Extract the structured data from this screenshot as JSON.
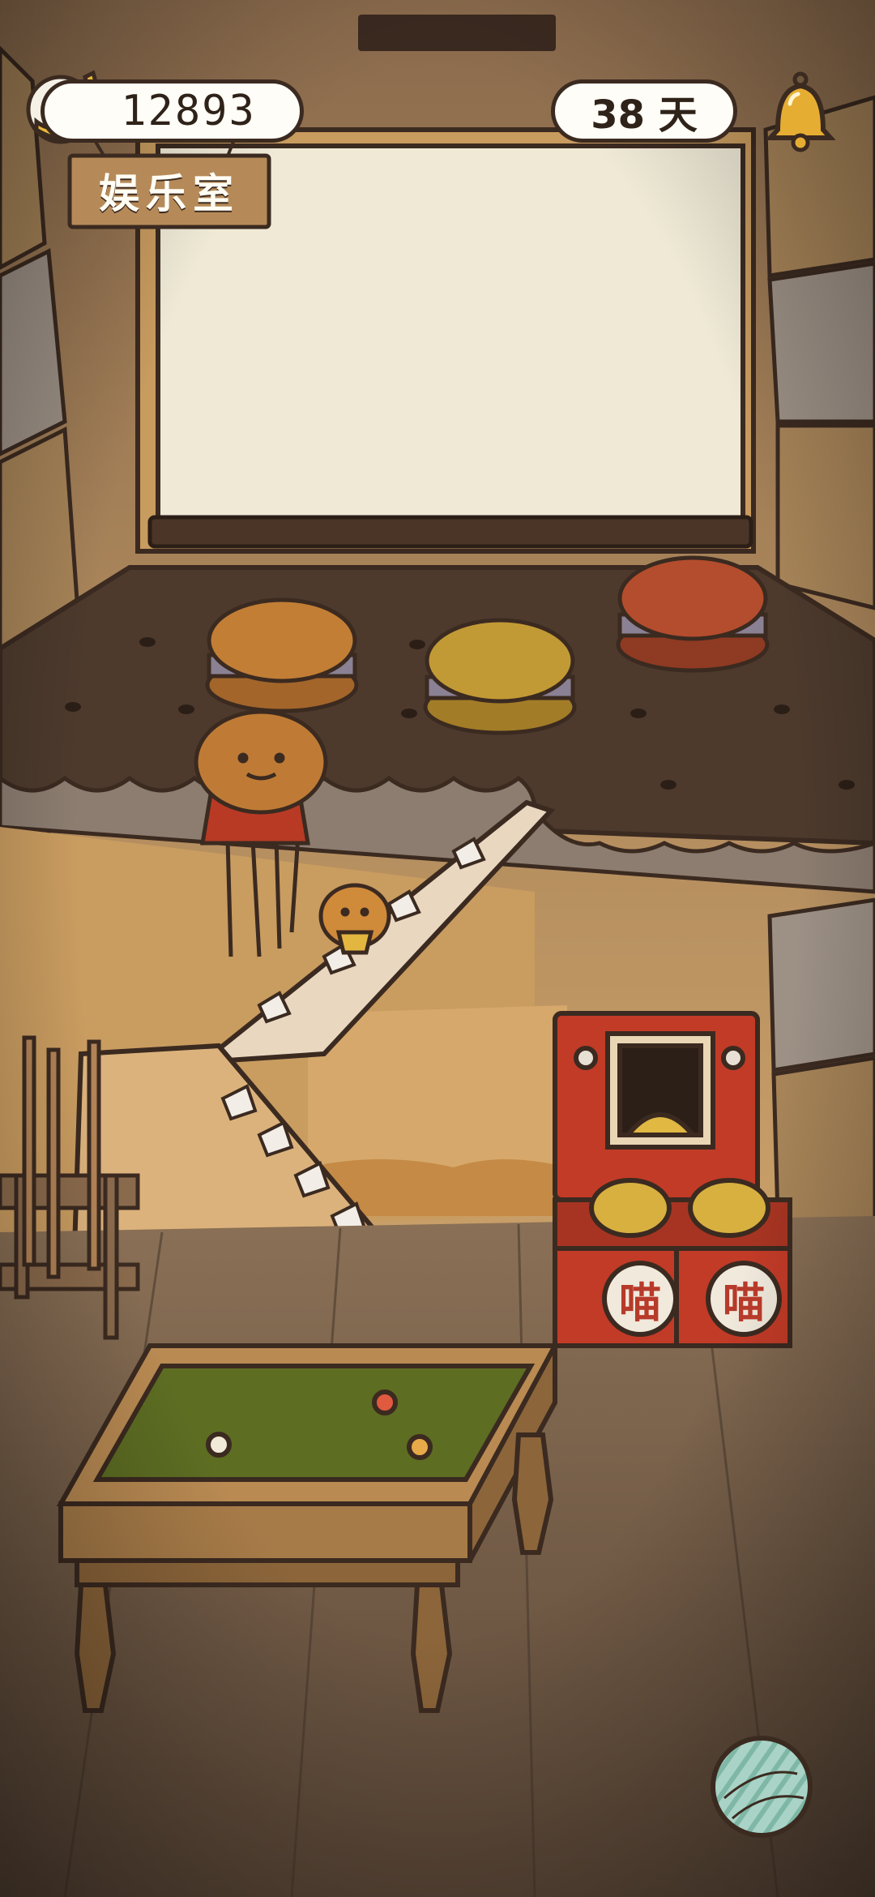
{
  "hud": {
    "banana_count": "12893",
    "days_label": "38 天",
    "room_name": "娱乐室"
  },
  "icons": {
    "currency": "banana-icon",
    "notifications": "bell-icon",
    "menu": "yarn-ball-icon"
  },
  "arcade": {
    "left_label": "喵",
    "right_label": "喵"
  },
  "colors": {
    "wall": "#c9a06a",
    "floor": "#6a5443",
    "screen": "#efe9d6",
    "felt": "#5d6d22",
    "arcade_red": "#c23b27",
    "macaron_orange": "#b9742d",
    "macaron_yellow": "#b5902b",
    "macaron_red": "#a4452a"
  }
}
